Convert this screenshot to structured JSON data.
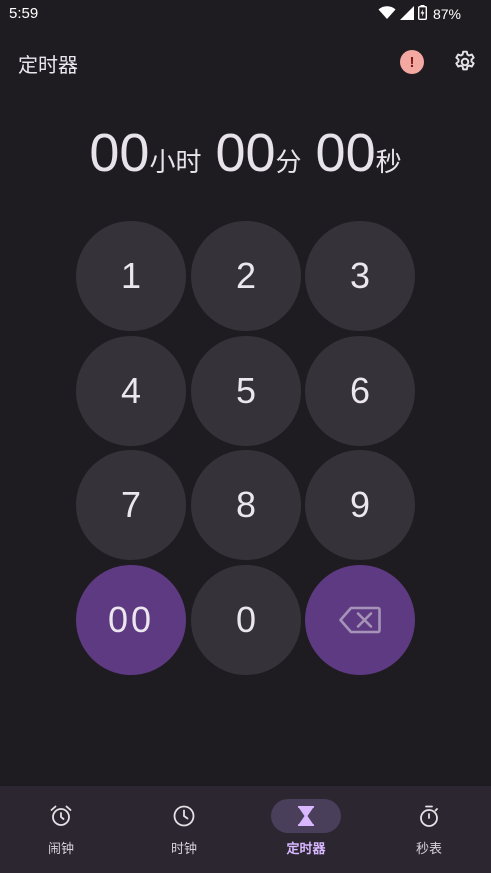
{
  "status_bar": {
    "time": "5:59",
    "battery_percent": "87%",
    "icons": [
      "wifi-icon",
      "signal-icon",
      "battery-icon"
    ]
  },
  "app_bar": {
    "title": "定时器",
    "alert_icon": "!",
    "settings_icon": "gear-icon"
  },
  "timer_display": {
    "hours": "00",
    "hours_unit": "小时",
    "minutes": "00",
    "minutes_unit": "分",
    "seconds": "00",
    "seconds_unit": "秒"
  },
  "keypad": {
    "keys": [
      "1",
      "2",
      "3",
      "4",
      "5",
      "6",
      "7",
      "8",
      "9",
      "00",
      "0"
    ],
    "backspace_icon": "backspace-icon"
  },
  "bottom_nav": {
    "items": [
      {
        "label": "闹钟",
        "icon": "alarm-icon",
        "active": false
      },
      {
        "label": "时钟",
        "icon": "clock-icon",
        "active": false
      },
      {
        "label": "定时器",
        "icon": "hourglass-icon",
        "active": true
      },
      {
        "label": "秒表",
        "icon": "stopwatch-icon",
        "active": false
      }
    ]
  },
  "colors": {
    "background": "#1f1c21",
    "key_background": "#36323a",
    "key_accent": "#5e3a82",
    "nav_background": "#2b2630",
    "nav_active_pill": "#4a3f5a",
    "nav_active_label": "#d9b8ff",
    "alert_background": "#f4a8a2"
  }
}
